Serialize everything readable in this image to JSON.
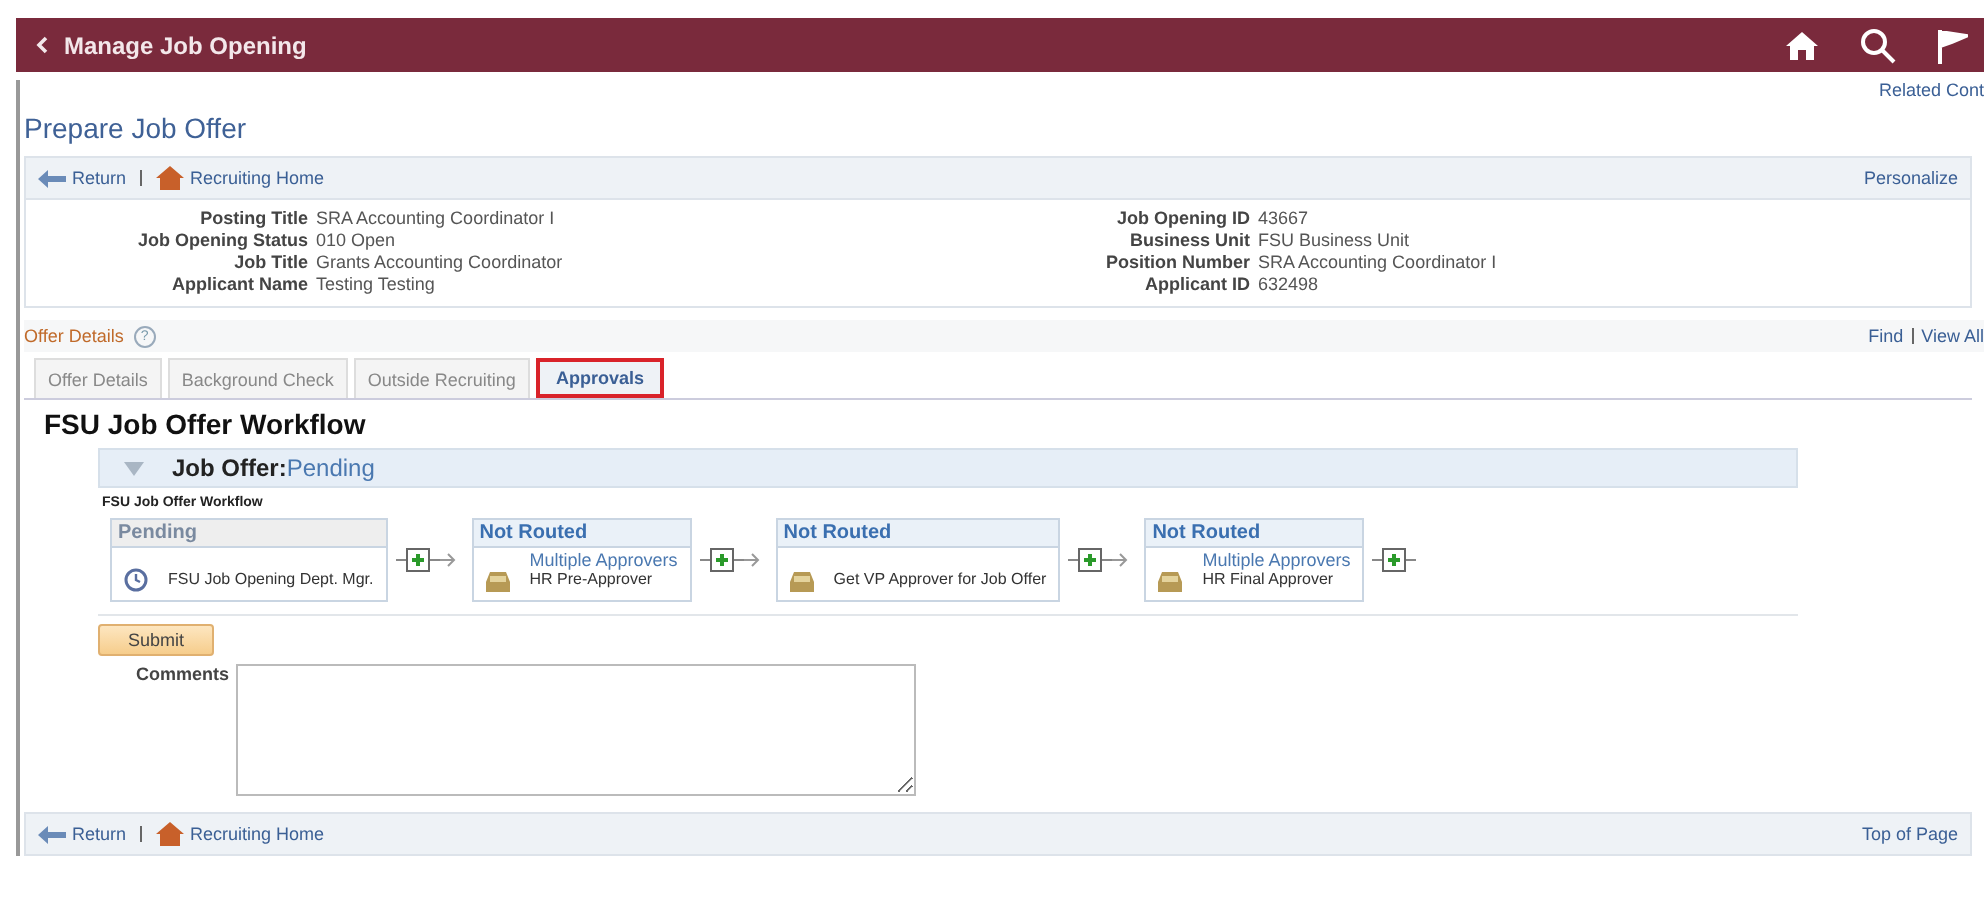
{
  "header": {
    "back_label": "Manage Job Opening"
  },
  "related_link": "Related Cont",
  "page_title": "Prepare Job Offer",
  "toolbar": {
    "return_label": "Return",
    "home_label": "Recruiting Home",
    "personalize": "Personalize"
  },
  "fields_left": [
    {
      "label": "Posting Title",
      "value": "SRA Accounting Coordinator I"
    },
    {
      "label": "Job Opening Status",
      "value": "010 Open"
    },
    {
      "label": "Job Title",
      "value": "Grants Accounting Coordinator"
    },
    {
      "label": "Applicant Name",
      "value": "Testing Testing"
    }
  ],
  "fields_right": [
    {
      "label": "Job Opening ID",
      "value": "43667"
    },
    {
      "label": "Business Unit",
      "value": "FSU Business Unit"
    },
    {
      "label": "Position Number",
      "value": "SRA Accounting Coordinator I"
    },
    {
      "label": "Applicant ID",
      "value": "632498"
    }
  ],
  "section": {
    "title": "Offer Details",
    "help": "?",
    "find": "Find",
    "view_all": "View All"
  },
  "tabs": [
    {
      "label": "Offer Details",
      "selected": false
    },
    {
      "label": "Background Check",
      "selected": false
    },
    {
      "label": "Outside Recruiting",
      "selected": false
    },
    {
      "label": "Approvals",
      "selected": true
    }
  ],
  "workflow_title": "FSU Job Offer Workflow",
  "panel": {
    "heading": "Job Offer:",
    "status": "Pending",
    "expanded": true,
    "subtitle": "FSU Job Offer Workflow"
  },
  "steps": [
    {
      "status": "Pending",
      "active": true,
      "kind": "clock",
      "name": "FSU Job Opening Dept. Mgr."
    },
    {
      "status": "Not Routed",
      "active": false,
      "kind": "inbox",
      "link": "Multiple Approvers",
      "name": "HR Pre-Approver"
    },
    {
      "status": "Not Routed",
      "active": false,
      "kind": "inbox",
      "name": "Get VP Approver for Job Offer"
    },
    {
      "status": "Not Routed",
      "active": false,
      "kind": "inbox",
      "link": "Multiple Approvers",
      "name": "HR Final Approver"
    }
  ],
  "submit": "Submit",
  "comments_label": "Comments",
  "footer": {
    "return_label": "Return",
    "home_label": "Recruiting Home",
    "top": "Top of Page"
  }
}
